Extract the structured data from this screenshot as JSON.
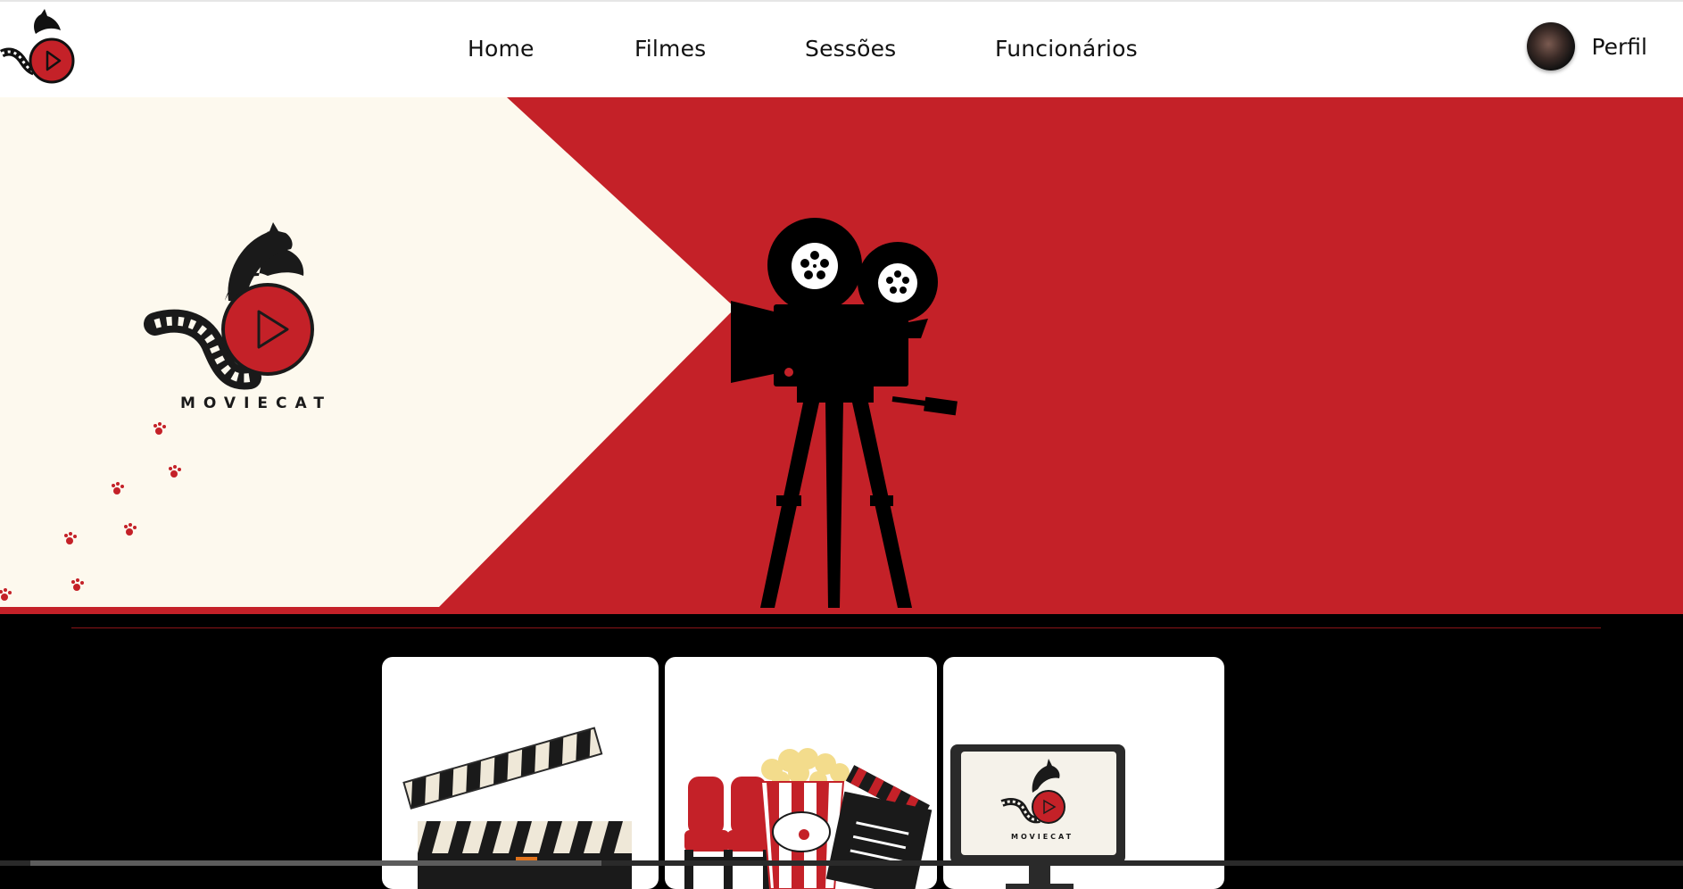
{
  "nav": {
    "links": [
      "Home",
      "Filmes",
      "Sessões",
      "Funcionários"
    ],
    "profile_label": "Perfil"
  },
  "hero": {
    "brand_text": "MOVIECAT"
  },
  "cards": [
    {
      "name": "filmes-card"
    },
    {
      "name": "sessoes-card"
    },
    {
      "name": "funcionarios-card"
    }
  ],
  "colors": {
    "brand_red": "#c42128",
    "cream": "#fdf9ee",
    "black": "#000000"
  }
}
